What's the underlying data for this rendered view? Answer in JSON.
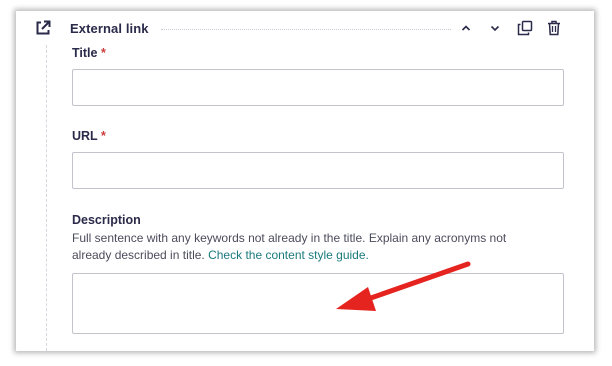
{
  "block": {
    "title": "External link",
    "icon": "external-link-icon",
    "actions": [
      {
        "name": "move-up-button",
        "icon": "chevron-up-icon"
      },
      {
        "name": "move-down-button",
        "icon": "chevron-down-icon"
      },
      {
        "name": "duplicate-button",
        "icon": "copy-icon"
      },
      {
        "name": "delete-button",
        "icon": "trash-icon"
      }
    ]
  },
  "fields": {
    "title": {
      "label": "Title",
      "required_marker": "*",
      "value": ""
    },
    "url": {
      "label": "URL",
      "required_marker": "*",
      "value": ""
    },
    "description": {
      "label": "Description",
      "help_text": "Full sentence with any keywords not already in the title. Explain any acronyms not already described in title.",
      "help_link": "Check the content style guide.",
      "value": ""
    }
  },
  "annotation": {
    "type": "arrow",
    "color": "#e52420",
    "points_to": "description-field"
  },
  "colors": {
    "heading": "#2a2a4a",
    "required": "#cd3c3c",
    "link": "#1a7a7d",
    "border": "#c3c3cc"
  }
}
